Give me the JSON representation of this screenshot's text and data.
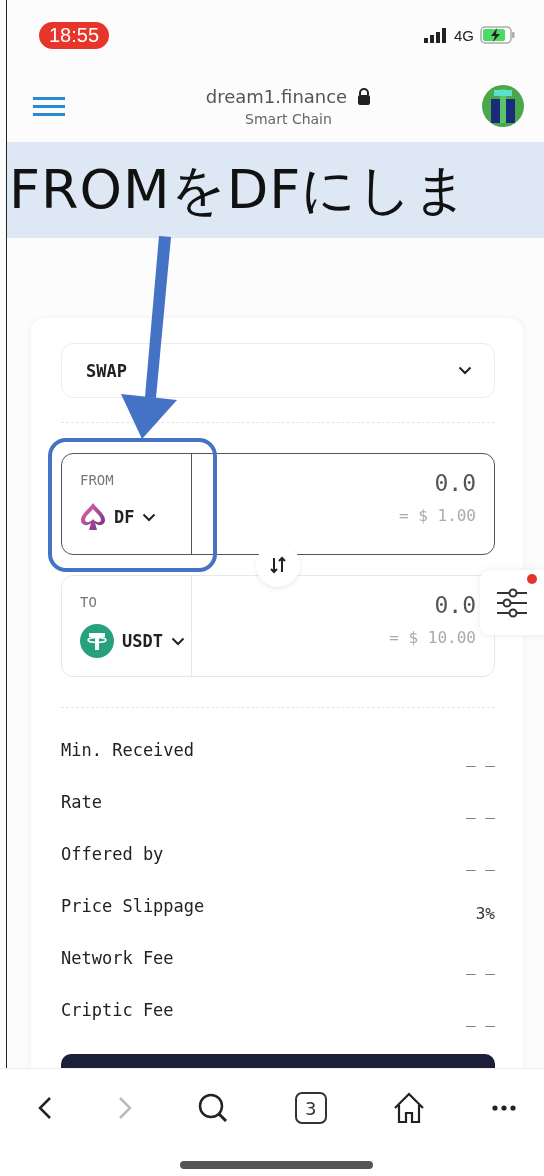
{
  "status_bar": {
    "time": "18:55",
    "network": "4G"
  },
  "browser": {
    "url": "dream1.finance",
    "network_name": "Smart Chain"
  },
  "annotation": {
    "text": "FROMをDFにしま"
  },
  "swap": {
    "mode": "SWAP",
    "from": {
      "label": "FROM",
      "token": "DF",
      "kind": "spade",
      "amount": "0.0",
      "usd": "= $ 1.00",
      "focused": true,
      "highlighted": true
    },
    "to": {
      "label": "TO",
      "token": "USDT",
      "kind": "tether",
      "amount": "0.0",
      "usd": "= $ 10.00",
      "focused": false,
      "highlighted": false
    },
    "settings_notification": true,
    "details": [
      {
        "label": "Min. Received",
        "value": "_ _"
      },
      {
        "label": "Rate",
        "value": "_ _"
      },
      {
        "label": "Offered by",
        "value": "_ _"
      },
      {
        "label": "Price Slippage",
        "value": "3%"
      },
      {
        "label": "Network Fee",
        "value": "_ _"
      },
      {
        "label": "Criptic Fee",
        "value": "_ _"
      }
    ]
  },
  "toolbar": {
    "tab_count": "3",
    "forward_disabled": true
  }
}
